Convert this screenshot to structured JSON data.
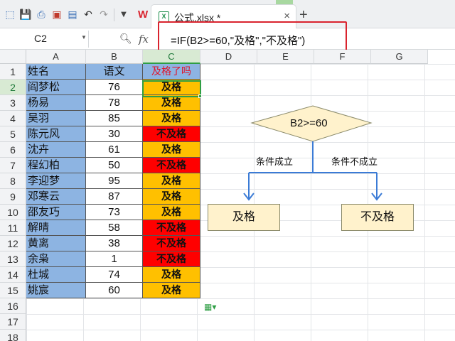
{
  "tab": {
    "filename": "公式.xlsx *",
    "close": "×",
    "new": "+"
  },
  "formula_bar": {
    "cell_ref": "C2",
    "fx": "fx",
    "formula": "=IF(B2>=60,\"及格\",\"不及格\")"
  },
  "columns": [
    "A",
    "B",
    "C",
    "D",
    "E",
    "F",
    "G"
  ],
  "rows": [
    "1",
    "2",
    "3",
    "4",
    "5",
    "6",
    "7",
    "8",
    "9",
    "10",
    "11",
    "12",
    "13",
    "14",
    "15",
    "16",
    "17",
    "18"
  ],
  "headers": {
    "name": "姓名",
    "score": "语文",
    "result": "及格了吗"
  },
  "students": [
    {
      "name": "阎梦松",
      "score": "76",
      "result": "及格",
      "status": "pass"
    },
    {
      "name": "杨易",
      "score": "78",
      "result": "及格",
      "status": "pass"
    },
    {
      "name": "吴羽",
      "score": "85",
      "result": "及格",
      "status": "pass"
    },
    {
      "name": "陈元风",
      "score": "30",
      "result": "不及格",
      "status": "fail"
    },
    {
      "name": "沈卉",
      "score": "61",
      "result": "及格",
      "status": "pass"
    },
    {
      "name": "程幻柏",
      "score": "50",
      "result": "不及格",
      "status": "fail"
    },
    {
      "name": "李迎梦",
      "score": "95",
      "result": "及格",
      "status": "pass"
    },
    {
      "name": "邓寒云",
      "score": "87",
      "result": "及格",
      "status": "pass"
    },
    {
      "name": "邵友巧",
      "score": "73",
      "result": "及格",
      "status": "pass"
    },
    {
      "name": "解晴",
      "score": "58",
      "result": "不及格",
      "status": "fail"
    },
    {
      "name": "黄离",
      "score": "38",
      "result": "不及格",
      "status": "fail"
    },
    {
      "name": "余枭",
      "score": "1",
      "result": "不及格",
      "status": "fail"
    },
    {
      "name": "杜城",
      "score": "74",
      "result": "及格",
      "status": "pass"
    },
    {
      "name": "姚宸",
      "score": "60",
      "result": "及格",
      "status": "pass"
    }
  ],
  "flowchart": {
    "condition": "B2>=60",
    "true_label": "条件成立",
    "false_label": "条件不成立",
    "true_result": "及格",
    "false_result": "不及格"
  },
  "colors": {
    "pass": "#ffc000",
    "fail": "#ff0000",
    "name_fill": "#8db4e2",
    "decision_fill": "#fff2cc",
    "arrow": "#3b7bd6"
  },
  "icons": [
    "save-icon",
    "print-icon",
    "pdf-icon",
    "print-preview-icon",
    "undo-icon",
    "redo-icon",
    "dropdown-icon",
    "wps-logo-icon",
    "excel-file-icon",
    "zoom-icon",
    "paste-options-icon"
  ]
}
